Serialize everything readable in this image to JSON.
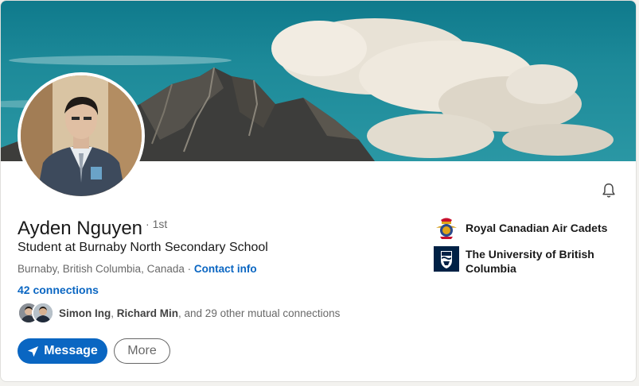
{
  "profile": {
    "name": "Ayden Nguyen",
    "degree": "· 1st",
    "headline": "Student at Burnaby North Secondary School",
    "location": "Burnaby, British Columbia, Canada",
    "separator": "·",
    "contact_info": "Contact info",
    "connections": "42 connections",
    "mutual": {
      "name1": "Simon Ing",
      "comma": ", ",
      "name2": "Richard Min",
      "rest": ", and 29 other mutual connections"
    }
  },
  "actions": {
    "message_label": "Message",
    "more_label": "More"
  },
  "organizations": [
    {
      "name": "Royal Canadian Air Cadets",
      "icon": "air-cadets-crest-icon"
    },
    {
      "name": "The University of British Columbia",
      "icon": "ubc-crest-icon"
    }
  ],
  "icons": {
    "bell": "bell-icon",
    "send": "paper-plane-icon"
  },
  "colors": {
    "primary": "#0a66c2",
    "banner_sky": "#1d8a99",
    "ubc_navy": "#002145"
  }
}
